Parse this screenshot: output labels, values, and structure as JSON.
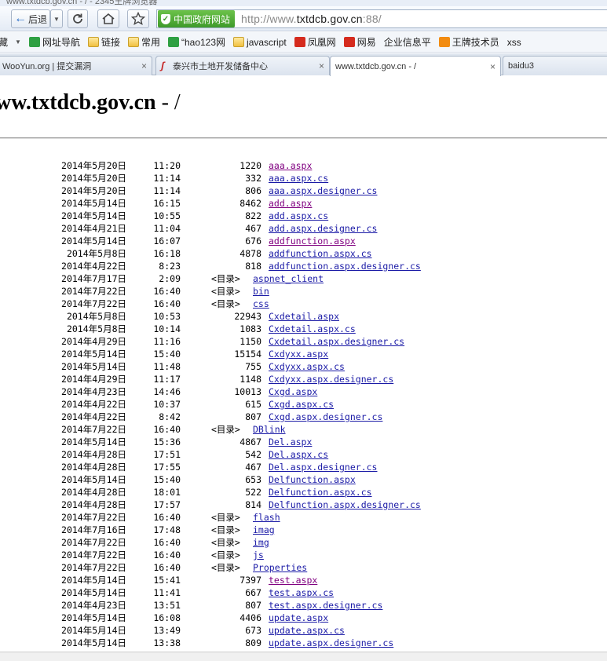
{
  "browser": {
    "window_title_fragment": "www.txtdcb.gov.cn - / - 2345王牌浏览器",
    "back_label": "后退",
    "gov_badge": "中国政府网站",
    "url_prefix": "http://www.",
    "url_host": "txtdcb.gov.cn",
    "url_suffix": ":88/"
  },
  "bookmarks": [
    {
      "label": "藏",
      "icon": "collections-icon"
    },
    {
      "label": "网址导航",
      "icon": "2345-nav-icon"
    },
    {
      "label": "链接",
      "icon": "folder-icon"
    },
    {
      "label": "常用",
      "icon": "folder-icon"
    },
    {
      "label": "“hao123网",
      "icon": "hao123-icon"
    },
    {
      "label": "javascript",
      "icon": "folder-icon"
    },
    {
      "label": "凤凰网",
      "icon": "ifeng-icon"
    },
    {
      "label": "网易",
      "icon": "netease-icon"
    },
    {
      "label": "企业信息平",
      "icon": "page-icon"
    },
    {
      "label": "王牌技术员",
      "icon": "tech-icon"
    },
    {
      "label": "xss",
      "icon": "page-icon"
    }
  ],
  "tabs": [
    {
      "label": "WooYun.org | 提交漏洞",
      "active": false
    },
    {
      "label": "泰兴市土地开发储备中心",
      "active": false
    },
    {
      "label": "www.txtdcb.gov.cn - /",
      "active": true
    },
    {
      "label": "baidu3",
      "active": false
    }
  ],
  "page": {
    "title_host": "ww.txtdcb.gov.cn",
    "title_rest": " - /"
  },
  "listing": [
    {
      "date": "2014年5月20日",
      "time": "11:20",
      "size": "1220",
      "name": "aaa.aspx",
      "dir": false,
      "visited": true
    },
    {
      "date": "2014年5月20日",
      "time": "11:14",
      "size": "332",
      "name": "aaa.aspx.cs",
      "dir": false,
      "visited": false
    },
    {
      "date": "2014年5月20日",
      "time": "11:14",
      "size": "806",
      "name": "aaa.aspx.designer.cs",
      "dir": false,
      "visited": false
    },
    {
      "date": "2014年5月14日",
      "time": "16:15",
      "size": "8462",
      "name": "add.aspx",
      "dir": false,
      "visited": true
    },
    {
      "date": "2014年5月14日",
      "time": "10:55",
      "size": "822",
      "name": "add.aspx.cs",
      "dir": false,
      "visited": false
    },
    {
      "date": "2014年4月21日",
      "time": "11:04",
      "size": "467",
      "name": "add.aspx.designer.cs",
      "dir": false,
      "visited": false
    },
    {
      "date": "2014年5月14日",
      "time": "16:07",
      "size": "676",
      "name": "addfunction.aspx",
      "dir": false,
      "visited": true
    },
    {
      "date": "2014年5月8日",
      "time": "16:18",
      "size": "4878",
      "name": "addfunction.aspx.cs",
      "dir": false,
      "visited": false
    },
    {
      "date": "2014年4月22日",
      "time": "8:23",
      "size": "818",
      "name": "addfunction.aspx.designer.cs",
      "dir": false,
      "visited": false
    },
    {
      "date": "2014年7月17日",
      "time": "2:09",
      "size": "",
      "name": "aspnet_client",
      "dir": true,
      "visited": false
    },
    {
      "date": "2014年7月22日",
      "time": "16:40",
      "size": "",
      "name": "bin",
      "dir": true,
      "visited": false
    },
    {
      "date": "2014年7月22日",
      "time": "16:40",
      "size": "",
      "name": "css",
      "dir": true,
      "visited": false
    },
    {
      "date": "2014年5月8日",
      "time": "10:53",
      "size": "22943",
      "name": "Cxdetail.aspx",
      "dir": false,
      "visited": false
    },
    {
      "date": "2014年5月8日",
      "time": "10:14",
      "size": "1083",
      "name": "Cxdetail.aspx.cs",
      "dir": false,
      "visited": false
    },
    {
      "date": "2014年4月29日",
      "time": "11:16",
      "size": "1150",
      "name": "Cxdetail.aspx.designer.cs",
      "dir": false,
      "visited": false
    },
    {
      "date": "2014年5月14日",
      "time": "15:40",
      "size": "15154",
      "name": "Cxdyxx.aspx",
      "dir": false,
      "visited": false
    },
    {
      "date": "2014年5月14日",
      "time": "11:48",
      "size": "755",
      "name": "Cxdyxx.aspx.cs",
      "dir": false,
      "visited": false
    },
    {
      "date": "2014年4月29日",
      "time": "11:17",
      "size": "1148",
      "name": "Cxdyxx.aspx.designer.cs",
      "dir": false,
      "visited": false
    },
    {
      "date": "2014年4月23日",
      "time": "14:46",
      "size": "10013",
      "name": "Cxgd.aspx",
      "dir": false,
      "visited": false
    },
    {
      "date": "2014年4月22日",
      "time": "10:37",
      "size": "615",
      "name": "Cxgd.aspx.cs",
      "dir": false,
      "visited": false
    },
    {
      "date": "2014年4月22日",
      "time": "8:42",
      "size": "807",
      "name": "Cxgd.aspx.designer.cs",
      "dir": false,
      "visited": false
    },
    {
      "date": "2014年7月22日",
      "time": "16:40",
      "size": "",
      "name": "DBlink",
      "dir": true,
      "visited": false
    },
    {
      "date": "2014年5月14日",
      "time": "15:36",
      "size": "4867",
      "name": "Del.aspx",
      "dir": false,
      "visited": false
    },
    {
      "date": "2014年4月28日",
      "time": "17:51",
      "size": "542",
      "name": "Del.aspx.cs",
      "dir": false,
      "visited": false
    },
    {
      "date": "2014年4月28日",
      "time": "17:55",
      "size": "467",
      "name": "Del.aspx.designer.cs",
      "dir": false,
      "visited": false
    },
    {
      "date": "2014年5月14日",
      "time": "15:40",
      "size": "653",
      "name": "Delfunction.aspx",
      "dir": false,
      "visited": false
    },
    {
      "date": "2014年4月28日",
      "time": "18:01",
      "size": "522",
      "name": "Delfunction.aspx.cs",
      "dir": false,
      "visited": false
    },
    {
      "date": "2014年4月28日",
      "time": "17:57",
      "size": "814",
      "name": "Delfunction.aspx.designer.cs",
      "dir": false,
      "visited": false
    },
    {
      "date": "2014年7月22日",
      "time": "16:40",
      "size": "",
      "name": "flash",
      "dir": true,
      "visited": false
    },
    {
      "date": "2014年7月16日",
      "time": "17:48",
      "size": "",
      "name": "imag",
      "dir": true,
      "visited": false
    },
    {
      "date": "2014年7月22日",
      "time": "16:40",
      "size": "",
      "name": "img",
      "dir": true,
      "visited": false
    },
    {
      "date": "2014年7月22日",
      "time": "16:40",
      "size": "",
      "name": "js",
      "dir": true,
      "visited": false
    },
    {
      "date": "2014年7月22日",
      "time": "16:40",
      "size": "",
      "name": "Properties",
      "dir": true,
      "visited": false
    },
    {
      "date": "2014年5月14日",
      "time": "15:41",
      "size": "7397",
      "name": "test.aspx",
      "dir": false,
      "visited": true
    },
    {
      "date": "2014年5月14日",
      "time": "11:41",
      "size": "667",
      "name": "test.aspx.cs",
      "dir": false,
      "visited": false
    },
    {
      "date": "2014年4月23日",
      "time": "13:51",
      "size": "807",
      "name": "test.aspx.designer.cs",
      "dir": false,
      "visited": false
    },
    {
      "date": "2014年5月14日",
      "time": "16:08",
      "size": "4406",
      "name": "update.aspx",
      "dir": false,
      "visited": false
    },
    {
      "date": "2014年5月14日",
      "time": "13:49",
      "size": "673",
      "name": "update.aspx.cs",
      "dir": false,
      "visited": false
    },
    {
      "date": "2014年5月14日",
      "time": "13:38",
      "size": "809",
      "name": "update.aspx.designer.cs",
      "dir": false,
      "visited": false
    }
  ],
  "dir_tag": "<目录>",
  "colors": {
    "link": "#1a1aa6",
    "visited": "#800080",
    "gov_badge": "#3e9a2a"
  }
}
